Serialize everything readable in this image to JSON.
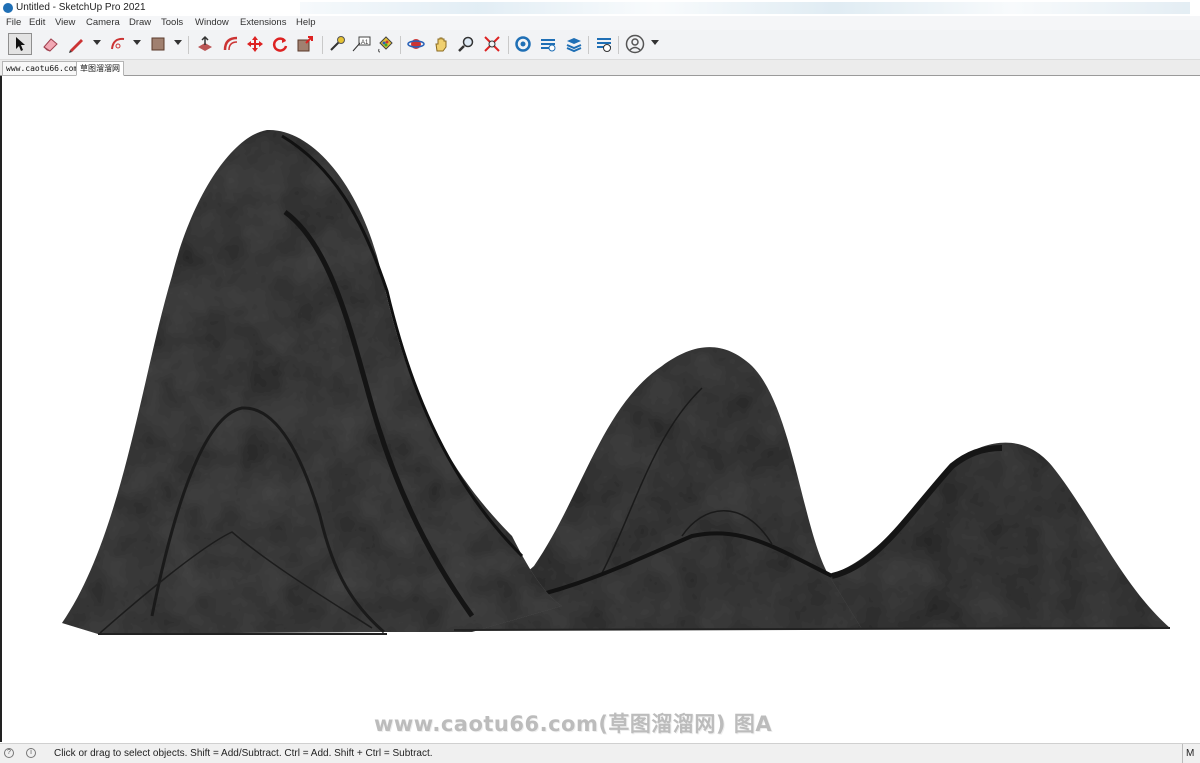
{
  "window": {
    "title": "Untitled - SketchUp Pro 2021"
  },
  "menu": [
    "File",
    "Edit",
    "View",
    "Camera",
    "Draw",
    "Tools",
    "Window",
    "Extensions",
    "Help"
  ],
  "toolbar": {
    "tools": [
      {
        "name": "select-tool-icon",
        "active": true
      },
      {
        "name": "eraser-tool-icon"
      },
      {
        "name": "pencil-line-tool-icon",
        "dropdown": true
      },
      {
        "name": "arc-tool-icon",
        "dropdown": true
      },
      {
        "name": "shape-tool-icon",
        "dropdown": true
      },
      {
        "name": "push-pull-tool-icon"
      },
      {
        "name": "offset-tool-icon"
      },
      {
        "name": "move-tool-icon"
      },
      {
        "name": "rotate-tool-icon"
      },
      {
        "name": "scale-tool-icon"
      },
      {
        "name": "tape-measure-tool-icon"
      },
      {
        "name": "text-tool-icon"
      },
      {
        "name": "paint-bucket-tool-icon"
      },
      {
        "name": "orbit-tool-icon"
      },
      {
        "name": "pan-tool-icon"
      },
      {
        "name": "zoom-tool-icon"
      },
      {
        "name": "zoom-extents-tool-icon"
      },
      {
        "name": "3d-warehouse-icon"
      },
      {
        "name": "extension-warehouse-icon"
      },
      {
        "name": "layout-icon"
      },
      {
        "name": "extension-manager-icon"
      },
      {
        "name": "account-icon",
        "dropdown": true
      }
    ]
  },
  "tabs": [
    {
      "label": "www.caotu66.com",
      "active": false
    },
    {
      "label": "草图溜溜网",
      "active": true
    }
  ],
  "viewport": {
    "model": "ink-wash-mountains",
    "rock_color": "#3d3d3d",
    "background": "#ffffff"
  },
  "watermark": "www.caotu66.com(草图溜溜网) 图A",
  "status": {
    "text": "Click or drag to select objects. Shift = Add/Subtract. Ctrl = Add. Shift + Ctrl = Subtract.",
    "measurements_label": "M"
  }
}
